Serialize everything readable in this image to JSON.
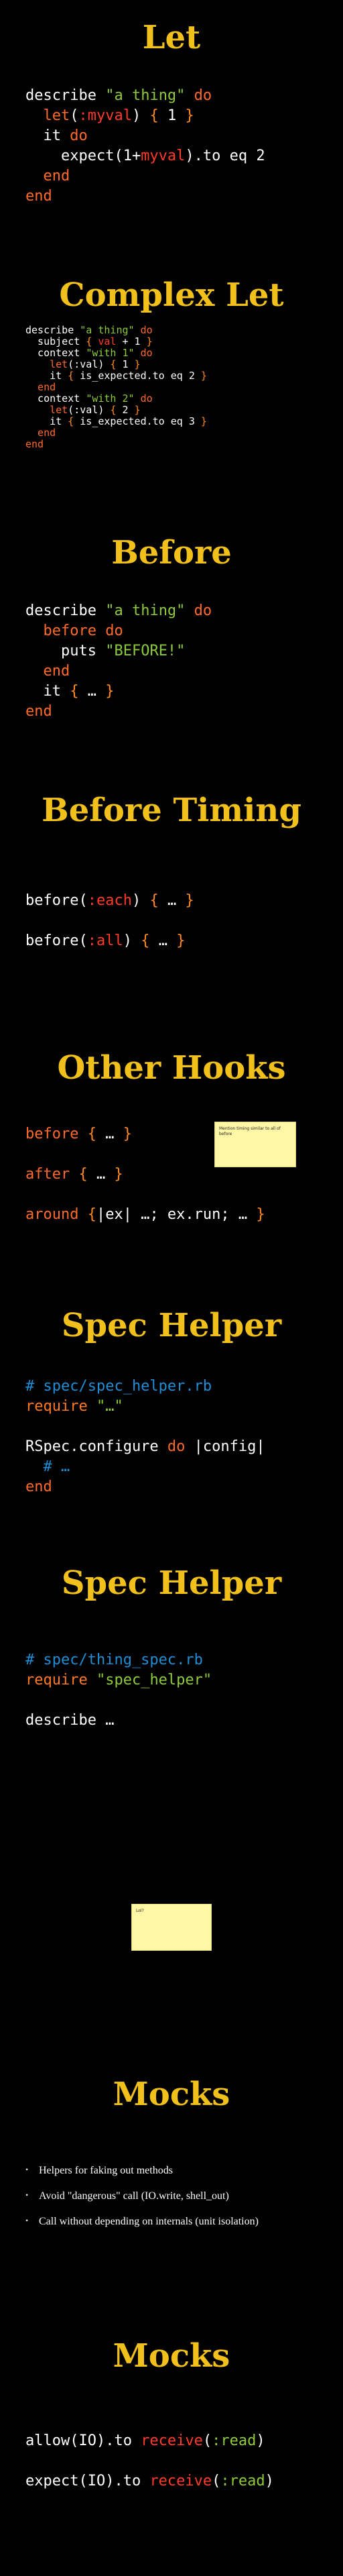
{
  "slides": [
    {
      "title": "Let",
      "code": [
        [
          [
            "describe ",
            "plain"
          ],
          [
            "\"a thing\"",
            "str"
          ],
          [
            " do",
            "kw"
          ]
        ],
        [
          [
            "  let",
            "kw"
          ],
          [
            "(",
            "plain"
          ],
          [
            ":myval",
            "sym"
          ],
          [
            ") ",
            "plain"
          ],
          [
            "{",
            "br"
          ],
          [
            " 1 ",
            "plain"
          ],
          [
            "}",
            "br"
          ]
        ],
        [
          [
            "  it ",
            "plain"
          ],
          [
            "do",
            "kw"
          ]
        ],
        [
          [
            "    expect(1+",
            "plain"
          ],
          [
            "myval",
            "ivar"
          ],
          [
            ").to eq 2",
            "plain"
          ]
        ],
        [
          [
            "  end",
            "kw"
          ]
        ],
        [
          [
            "end",
            "kw"
          ]
        ]
      ]
    },
    {
      "title": "Complex Let",
      "code": [
        [
          [
            "describe ",
            "plain"
          ],
          [
            "\"a thing\"",
            "str"
          ],
          [
            " do",
            "kw"
          ]
        ],
        [
          [
            "  subject ",
            "plain"
          ],
          [
            "{",
            "br"
          ],
          [
            " val",
            "ivar"
          ],
          [
            " + 1 ",
            "plain"
          ],
          [
            "}",
            "br"
          ]
        ],
        [
          [
            "  context ",
            "plain"
          ],
          [
            "\"with 1\"",
            "str"
          ],
          [
            " do",
            "kw"
          ]
        ],
        [
          [
            "    let",
            "kw"
          ],
          [
            "(:val) ",
            "plain"
          ],
          [
            "{",
            "br"
          ],
          [
            " 1 ",
            "plain"
          ],
          [
            "}",
            "br"
          ]
        ],
        [
          [
            "    it ",
            "plain"
          ],
          [
            "{",
            "br"
          ],
          [
            " is_expected.to eq 2 ",
            "plain"
          ],
          [
            "}",
            "br"
          ]
        ],
        [
          [
            "  end",
            "kw"
          ]
        ],
        [
          [
            "  context ",
            "plain"
          ],
          [
            "\"with 2\"",
            "str"
          ],
          [
            " do",
            "kw"
          ]
        ],
        [
          [
            "    let",
            "kw"
          ],
          [
            "(:val) ",
            "plain"
          ],
          [
            "{",
            "br"
          ],
          [
            " 2 ",
            "plain"
          ],
          [
            "}",
            "br"
          ]
        ],
        [
          [
            "    it ",
            "plain"
          ],
          [
            "{",
            "br"
          ],
          [
            " is_expected.to eq 3 ",
            "plain"
          ],
          [
            "}",
            "br"
          ]
        ],
        [
          [
            "  end",
            "kw"
          ]
        ],
        [
          [
            "end",
            "kw"
          ]
        ]
      ]
    },
    {
      "title": "Before",
      "code": [
        [
          [
            "describe ",
            "plain"
          ],
          [
            "\"a thing\"",
            "str"
          ],
          [
            " do",
            "kw"
          ]
        ],
        [
          [
            "  before ",
            "kw"
          ],
          [
            "do",
            "kw"
          ]
        ],
        [
          [
            "    puts ",
            "plain"
          ],
          [
            "\"BEFORE!\"",
            "str"
          ]
        ],
        [
          [
            "  end",
            "kw"
          ]
        ],
        [
          [
            "  it ",
            "plain"
          ],
          [
            "{",
            "br"
          ],
          [
            " … ",
            "plain"
          ],
          [
            "}",
            "br"
          ]
        ],
        [
          [
            "end",
            "kw"
          ]
        ]
      ]
    },
    {
      "title": "Before Timing",
      "code": [
        [
          [
            "before(",
            "plain"
          ],
          [
            ":each",
            "sym"
          ],
          [
            ") ",
            "plain"
          ],
          [
            "{",
            "br"
          ],
          [
            " … ",
            "plain"
          ],
          [
            "}",
            "br"
          ]
        ],
        [
          [
            "",
            "plain"
          ]
        ],
        [
          [
            "before(",
            "plain"
          ],
          [
            ":all",
            "sym"
          ],
          [
            ") ",
            "plain"
          ],
          [
            "{",
            "br"
          ],
          [
            " … ",
            "plain"
          ],
          [
            "}",
            "br"
          ]
        ]
      ]
    },
    {
      "title": "Other Hooks",
      "code": [
        [
          [
            "before ",
            "kw"
          ],
          [
            "{",
            "br"
          ],
          [
            " … ",
            "plain"
          ],
          [
            "}",
            "br"
          ]
        ],
        [
          [
            "",
            "plain"
          ]
        ],
        [
          [
            "after ",
            "kw"
          ],
          [
            "{",
            "br"
          ],
          [
            " … ",
            "plain"
          ],
          [
            "}",
            "br"
          ]
        ],
        [
          [
            "",
            "plain"
          ]
        ],
        [
          [
            "around ",
            "kw"
          ],
          [
            "{",
            "br"
          ],
          [
            "|ex| …; ex.run; … ",
            "plain"
          ],
          [
            "}",
            "br"
          ]
        ]
      ],
      "note": "Mention timing similar to all of before"
    },
    {
      "title": "Spec Helper",
      "code": [
        [
          [
            "# spec/spec_helper.rb",
            "cmt"
          ]
        ],
        [
          [
            "require ",
            "req"
          ],
          [
            "\"…\"",
            "str"
          ]
        ],
        [
          [
            "",
            "plain"
          ]
        ],
        [
          [
            "RSpec.configure ",
            "plain"
          ],
          [
            "do",
            "kw"
          ],
          [
            " |config|",
            "plain"
          ]
        ],
        [
          [
            "  # …",
            "cmt"
          ]
        ],
        [
          [
            "end",
            "kw"
          ]
        ]
      ]
    },
    {
      "title": "Spec Helper",
      "code": [
        [
          [
            "# spec/thing_spec.rb",
            "cmt"
          ]
        ],
        [
          [
            "require ",
            "req"
          ],
          [
            "\"spec_helper\"",
            "str"
          ]
        ],
        [
          [
            "",
            "plain"
          ]
        ],
        [
          [
            "describe …",
            "plain"
          ]
        ]
      ]
    },
    {
      "note": "Lol?"
    },
    {
      "title": "Mocks",
      "bullets": [
        "Helpers for faking out methods",
        "Avoid \"dangerous\" call (IO.write, shell_out)",
        "Call without depending on internals (unit isolation)"
      ]
    },
    {
      "title": "Mocks",
      "code": [
        [
          [
            "allow(IO).to ",
            "plain"
          ],
          [
            "receive",
            "sym"
          ],
          [
            "(",
            "plain"
          ],
          [
            ":read",
            "str"
          ],
          [
            ")",
            "plain"
          ]
        ],
        [
          [
            "",
            "plain"
          ]
        ],
        [
          [
            "expect(IO).to ",
            "plain"
          ],
          [
            "receive",
            "sym"
          ],
          [
            "(",
            "plain"
          ],
          [
            ":read",
            "str"
          ],
          [
            ")",
            "plain"
          ]
        ]
      ]
    }
  ],
  "colors": {
    "background": "#000000",
    "title": "#f2c01a",
    "keyword": "#ff6a2a",
    "string": "#8ecb3a",
    "symbol": "#ff3a2a",
    "comment": "#1e8fd6",
    "note": "#fff6a6"
  }
}
